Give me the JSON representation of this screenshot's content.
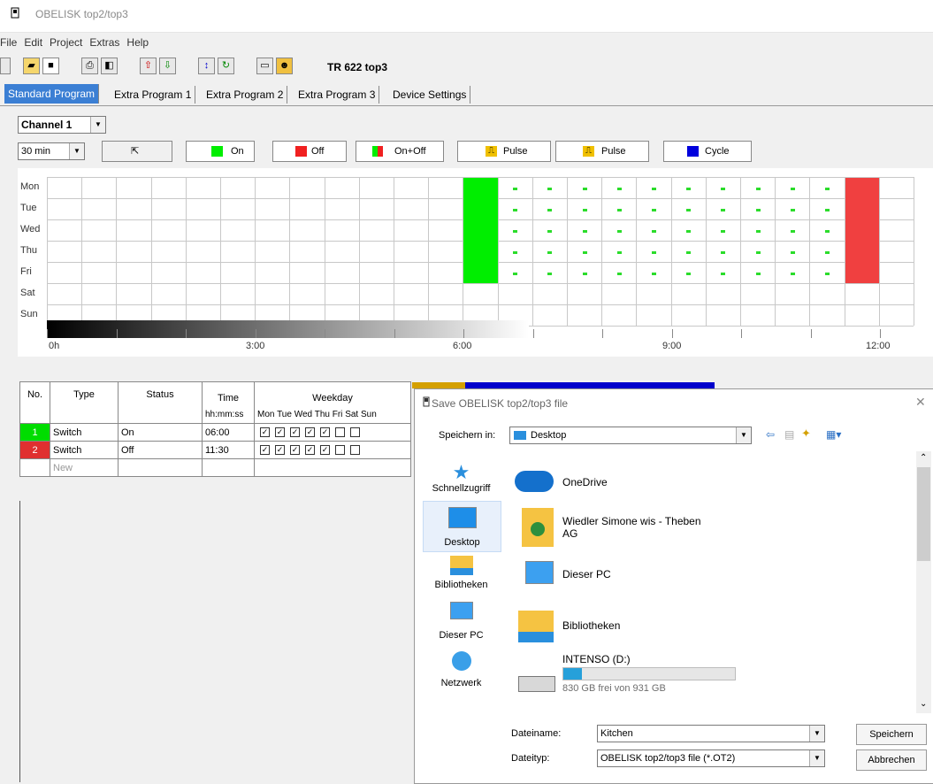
{
  "window": {
    "title": "OBELISK top2/top3"
  },
  "menu": [
    "File",
    "Edit",
    "Project",
    "Extras",
    "Help"
  ],
  "toolbar": {
    "device": "TR 622 top3"
  },
  "tabs": [
    "Standard Program",
    "Extra Program 1",
    "Extra Program 2",
    "Extra Program 3",
    "Device Settings"
  ],
  "channel": {
    "selected": "Channel 1"
  },
  "interval": {
    "selected": "30 min"
  },
  "buttons": {
    "on": "On",
    "off": "Off",
    "onoff": "On+Off",
    "pulse1": "Pulse",
    "pulse2": "Pulse",
    "cycle": "Cycle"
  },
  "colors": {
    "on": "#00ee00",
    "off": "#f04040",
    "cycle": "#0000dd",
    "pulse": "#f0c000"
  },
  "schedule": {
    "days": [
      "Mon",
      "Tue",
      "Wed",
      "Thu",
      "Fri",
      "Sat",
      "Sun"
    ],
    "time_labels": [
      "0h",
      "3:00",
      "6:00",
      "9:00",
      "12:00"
    ]
  },
  "program_table": {
    "headers": [
      "No.",
      "Type",
      "Status",
      "Time",
      "Weekday"
    ],
    "subheaders": {
      "time": "hh:mm:ss",
      "weekdays": [
        "Mon",
        "Tue",
        "Wed",
        "Thu",
        "Fri",
        "Sat",
        "Sun"
      ]
    },
    "rows": [
      {
        "no": "1",
        "type": "Switch",
        "status": "On",
        "time": "06:00"
      },
      {
        "no": "2",
        "type": "Switch",
        "status": "Off",
        "time": "11:30"
      },
      {
        "no": "",
        "type": "New",
        "status": "",
        "time": ""
      }
    ]
  },
  "dialog": {
    "title": "Save OBELISK top2/top3 file",
    "save_in_label": "Speichern in:",
    "save_in_value": "Desktop",
    "places": [
      "Schnellzugriff",
      "Desktop",
      "Bibliotheken",
      "Dieser PC",
      "Netzwerk"
    ],
    "files": [
      "OneDrive",
      "Wiedler Simone wis - Theben",
      "AG",
      "Dieser PC",
      "Bibliotheken",
      "INTENSO (D:)"
    ],
    "drive_free": "830 GB frei von 931 GB",
    "drive_fill": 0.11,
    "filename_label": "Dateiname:",
    "filename_value": "Kitchen",
    "filetype_label": "Dateityp:",
    "filetype_value": "OBELISK top2/top3 file (*.OT2)",
    "save_button": "Speichern",
    "cancel_button": "Abbrechen"
  }
}
